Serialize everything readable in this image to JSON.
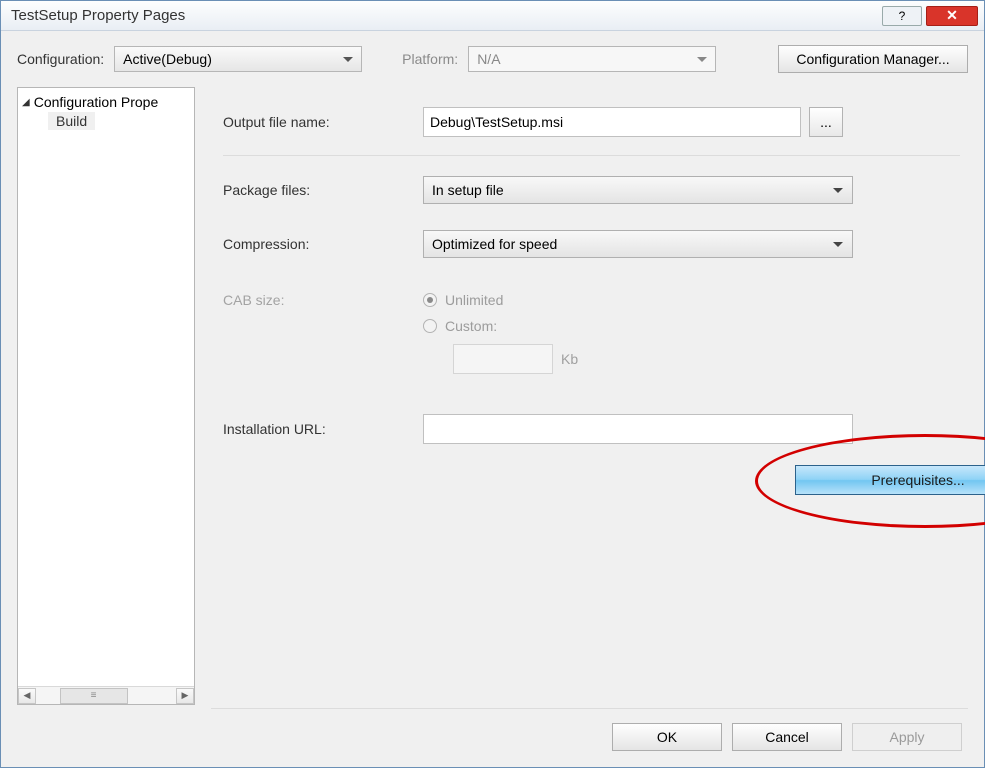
{
  "window": {
    "title": "TestSetup Property Pages"
  },
  "topbar": {
    "configuration_label": "Configuration:",
    "configuration_value": "Active(Debug)",
    "platform_label": "Platform:",
    "platform_value": "N/A",
    "config_manager_label": "Configuration Manager..."
  },
  "tree": {
    "root": "Configuration Prope",
    "child": "Build"
  },
  "form": {
    "output_label": "Output file name:",
    "output_value": "Debug\\TestSetup.msi",
    "package_label": "Package files:",
    "package_value": "In setup file",
    "compression_label": "Compression:",
    "compression_value": "Optimized for speed",
    "cab_label": "CAB size:",
    "cab_unlimited": "Unlimited",
    "cab_custom": "Custom:",
    "cab_kb_unit": "Kb",
    "install_url_label": "Installation URL:",
    "install_url_value": "",
    "prerequisites_label": "Prerequisites...",
    "browse_label": "..."
  },
  "footer": {
    "ok": "OK",
    "cancel": "Cancel",
    "apply": "Apply"
  }
}
